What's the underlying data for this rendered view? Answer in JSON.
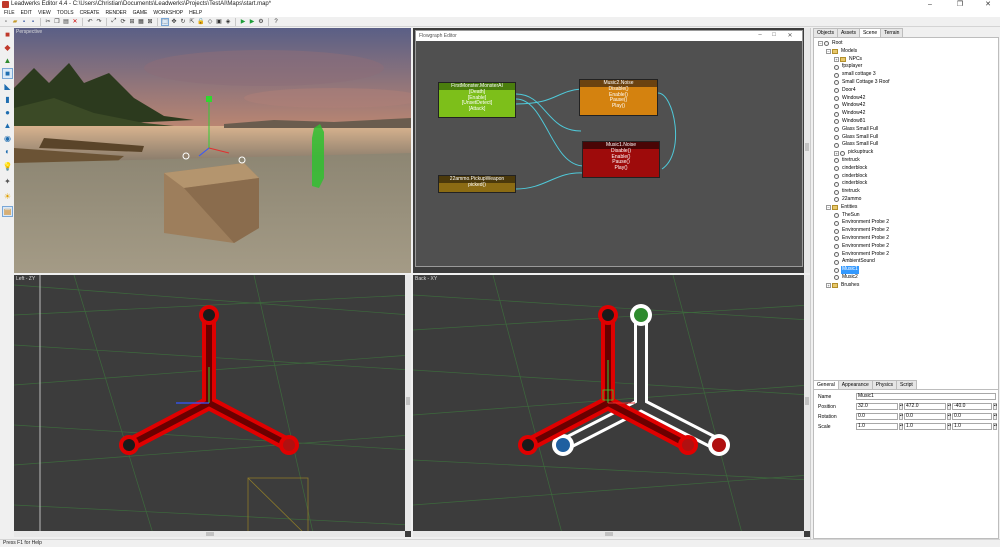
{
  "window": {
    "title": "Leadwerks Editor 4.4 - C:\\Users\\Christian\\Documents\\Leadwerks\\Projects\\TestAI\\Maps\\start.map*",
    "minimize": "–",
    "maximize": "❐",
    "close": "✕"
  },
  "menu": [
    "FILE",
    "EDIT",
    "VIEW",
    "TOOLS",
    "CREATE",
    "RENDER",
    "GAME",
    "WORKSHOP",
    "HELP"
  ],
  "viewports": {
    "perspective": "Perspective",
    "left": "Left - ZY",
    "back": "Back - XY"
  },
  "flowgraph": {
    "title": "Flowgraph Editor",
    "nodes": [
      {
        "title": "FirstMonster.MonsterAI",
        "rows": [
          "[Death]",
          "[Enable]",
          "[UnsetDetect]",
          "[Attack]"
        ],
        "color": "#7dbf1a"
      },
      {
        "title": "Music2.Noise",
        "rows": [
          "Disable()",
          "Enable()",
          "Pause()",
          "Play()"
        ],
        "color": "#d4820f"
      },
      {
        "title": "Music1.Noise",
        "rows": [
          "Disable()",
          "Enable()",
          "Pause()",
          "Play()"
        ],
        "color": "#9e0b0b"
      },
      {
        "title": "22ammo.PickupWeapon",
        "rows": [
          "picked()"
        ],
        "color": "#8b6b13"
      }
    ]
  },
  "right_tabs": [
    "Objects",
    "Assets",
    "Scene",
    "Terrain"
  ],
  "active_right_tab": "Scene",
  "scene_tree": [
    {
      "label": "Root",
      "depth": 0,
      "kind": "exp",
      "expanded": true
    },
    {
      "label": "Models",
      "depth": 1,
      "kind": "folder",
      "expanded": true
    },
    {
      "label": "NPCs",
      "depth": 2,
      "kind": "folder",
      "expanded": false
    },
    {
      "label": "fpsplayer",
      "depth": 2,
      "kind": "item"
    },
    {
      "label": "small cottage 3",
      "depth": 2,
      "kind": "item"
    },
    {
      "label": "Small Cottage 3 Roof",
      "depth": 2,
      "kind": "item"
    },
    {
      "label": "Door4",
      "depth": 2,
      "kind": "item"
    },
    {
      "label": "Window42",
      "depth": 2,
      "kind": "item"
    },
    {
      "label": "Window42",
      "depth": 2,
      "kind": "item"
    },
    {
      "label": "Window42",
      "depth": 2,
      "kind": "item"
    },
    {
      "label": "Window81",
      "depth": 2,
      "kind": "item"
    },
    {
      "label": "Glass Small Full",
      "depth": 2,
      "kind": "item"
    },
    {
      "label": "Glass Small Full",
      "depth": 2,
      "kind": "item"
    },
    {
      "label": "Glass Small Full",
      "depth": 2,
      "kind": "item"
    },
    {
      "label": "pickuptruck",
      "depth": 2,
      "kind": "item",
      "expandable": true
    },
    {
      "label": "tiretruck",
      "depth": 2,
      "kind": "item"
    },
    {
      "label": "cinderblock",
      "depth": 2,
      "kind": "item"
    },
    {
      "label": "cinderblock",
      "depth": 2,
      "kind": "item"
    },
    {
      "label": "cinderblock",
      "depth": 2,
      "kind": "item"
    },
    {
      "label": "tiretruck",
      "depth": 2,
      "kind": "item"
    },
    {
      "label": "22ammo",
      "depth": 2,
      "kind": "item"
    },
    {
      "label": "Entities",
      "depth": 1,
      "kind": "folder",
      "expanded": true
    },
    {
      "label": "TheSun",
      "depth": 2,
      "kind": "item"
    },
    {
      "label": "Environment Probe 2",
      "depth": 2,
      "kind": "item"
    },
    {
      "label": "Environment Probe 2",
      "depth": 2,
      "kind": "item"
    },
    {
      "label": "Environment Probe 2",
      "depth": 2,
      "kind": "item"
    },
    {
      "label": "Environment Probe 2",
      "depth": 2,
      "kind": "item"
    },
    {
      "label": "Environment Probe 2",
      "depth": 2,
      "kind": "item"
    },
    {
      "label": "AmbientSound",
      "depth": 2,
      "kind": "item"
    },
    {
      "label": "Music1",
      "depth": 2,
      "kind": "item",
      "selected": true
    },
    {
      "label": "Music2",
      "depth": 2,
      "kind": "item"
    },
    {
      "label": "Brushes",
      "depth": 1,
      "kind": "folder",
      "expanded": false
    }
  ],
  "prop_tabs": [
    "General",
    "Appearance",
    "Physics",
    "Script"
  ],
  "active_prop_tab": "General",
  "props": {
    "name_label": "Name",
    "name_value": "Music1",
    "position_label": "Position",
    "position": [
      "32.0",
      "472.0",
      "-40.0"
    ],
    "rotation_label": "Rotation",
    "rotation": [
      "0.0",
      "0.0",
      "0.0"
    ],
    "scale_label": "Scale",
    "scale": [
      "1.0",
      "1.0",
      "1.0"
    ]
  },
  "status": "Press F1 for Help"
}
